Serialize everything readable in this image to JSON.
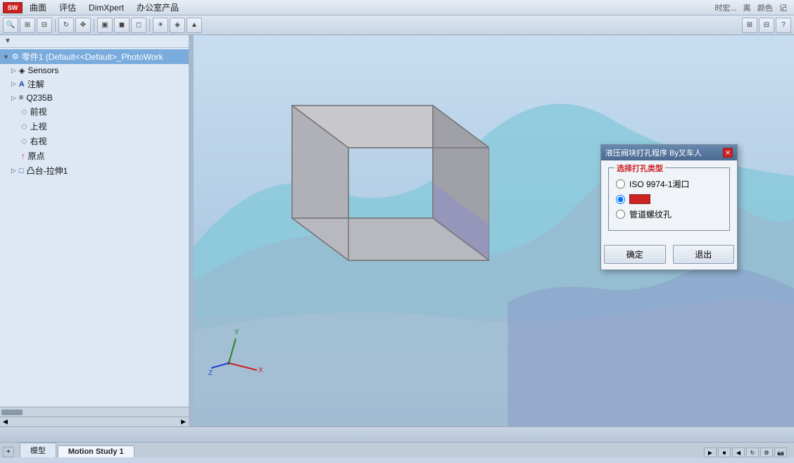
{
  "menubar": {
    "items": [
      "曲面",
      "评估",
      "DimXpert",
      "办公室产品"
    ]
  },
  "toolbar": {
    "buttons": [
      "zoom-in",
      "zoom-out",
      "zoom-fit",
      "rotate",
      "pan",
      "section-view",
      "display-style",
      "light",
      "appearance",
      "render"
    ],
    "right_buttons": [
      "expand",
      "collapse",
      "help"
    ]
  },
  "sidebar": {
    "filter_icon": "▼",
    "tree_items": [
      {
        "id": "part1",
        "label": "零件1 (Default<<Default>_PhotoWork",
        "icon": "⚙",
        "indent": 0,
        "selected": true
      },
      {
        "id": "sensors",
        "label": "Sensors",
        "icon": "◈",
        "indent": 1
      },
      {
        "id": "annotations",
        "label": "注解",
        "icon": "A",
        "indent": 1
      },
      {
        "id": "material",
        "label": "Q235B",
        "icon": "≡",
        "indent": 1
      },
      {
        "id": "front",
        "label": "前视",
        "icon": "◇",
        "indent": 1
      },
      {
        "id": "top",
        "label": "上视",
        "icon": "◇",
        "indent": 1
      },
      {
        "id": "right",
        "label": "右视",
        "icon": "◇",
        "indent": 1
      },
      {
        "id": "origin",
        "label": "原点",
        "icon": "↑",
        "indent": 1
      },
      {
        "id": "boss",
        "label": "凸台-拉伸1",
        "icon": "□",
        "indent": 1,
        "expanded": true
      }
    ]
  },
  "viewport": {
    "bg_color_top": "#d8e8f4",
    "bg_color_bottom": "#a0b8d0"
  },
  "dialog": {
    "title": "液压阀块打孔程序 By叉车人",
    "close_btn": "✕",
    "group_title": "选择打孔类型",
    "options": [
      {
        "id": "opt1",
        "label": "ISO 9974-1湘口",
        "selected": false
      },
      {
        "id": "opt2",
        "label": "",
        "selected": true,
        "has_box": true
      },
      {
        "id": "opt3",
        "label": "管道螺纹孔",
        "selected": false
      }
    ],
    "buttons": [
      {
        "id": "confirm",
        "label": "确定"
      },
      {
        "id": "cancel",
        "label": "退出"
      }
    ]
  },
  "statusbar": {
    "text": ""
  },
  "bottom_tabs": [
    {
      "id": "model",
      "label": "模型",
      "active": false
    },
    {
      "id": "motion1",
      "label": "Motion Study 1",
      "active": true
    }
  ],
  "bottom_toolbar": {
    "buttons": [
      "play",
      "stop",
      "rewind",
      "loop",
      "settings",
      "camera"
    ]
  }
}
